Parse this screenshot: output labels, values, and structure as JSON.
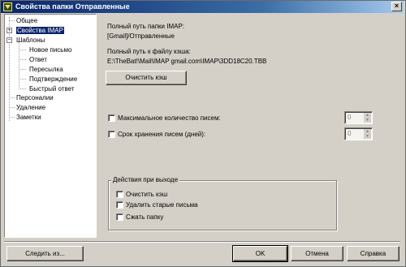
{
  "window": {
    "title": "Свойства папки Отправленные",
    "close_symbol": "×"
  },
  "tree": {
    "items": [
      {
        "label": "Общее"
      },
      {
        "label": "Свойства IMAP",
        "expander": "+"
      },
      {
        "label": "Шаблоны",
        "expander": "−"
      },
      {
        "label": "Новое письмо"
      },
      {
        "label": "Ответ"
      },
      {
        "label": "Пересылка"
      },
      {
        "label": "Подтверждение"
      },
      {
        "label": "Быстрый ответ"
      },
      {
        "label": "Персоналии"
      },
      {
        "label": "Удаление"
      },
      {
        "label": "Заметки"
      }
    ]
  },
  "imap": {
    "path_label": "Полный путь папки IMAP:",
    "path_value": "[Gmail]/Отправленные",
    "cache_label": "Полный путь к файлу кэша:",
    "cache_value": "E:\\TheBat!\\Mail\\IMAP gmail.com\\IMAP\\3DD18C20.TBB",
    "clear_cache_button": "Очистить кэш"
  },
  "options": {
    "max_messages_label": "Максимальное количество писем:",
    "max_messages_value": "0",
    "max_messages_checked": false,
    "retention_label": "Срок хранения писем (дней):",
    "retention_value": "0",
    "retention_checked": false
  },
  "exit_actions": {
    "title": "Действия при выходе",
    "items": [
      {
        "label": "Очистить кэш",
        "checked": false
      },
      {
        "label": "Удалить старые письма",
        "checked": false
      },
      {
        "label": "Сжать папку",
        "checked": false
      }
    ]
  },
  "footer": {
    "follow_button": "Следить из...",
    "ok_button": "OK",
    "cancel_button": "Отмена",
    "help_button": "Справка"
  }
}
